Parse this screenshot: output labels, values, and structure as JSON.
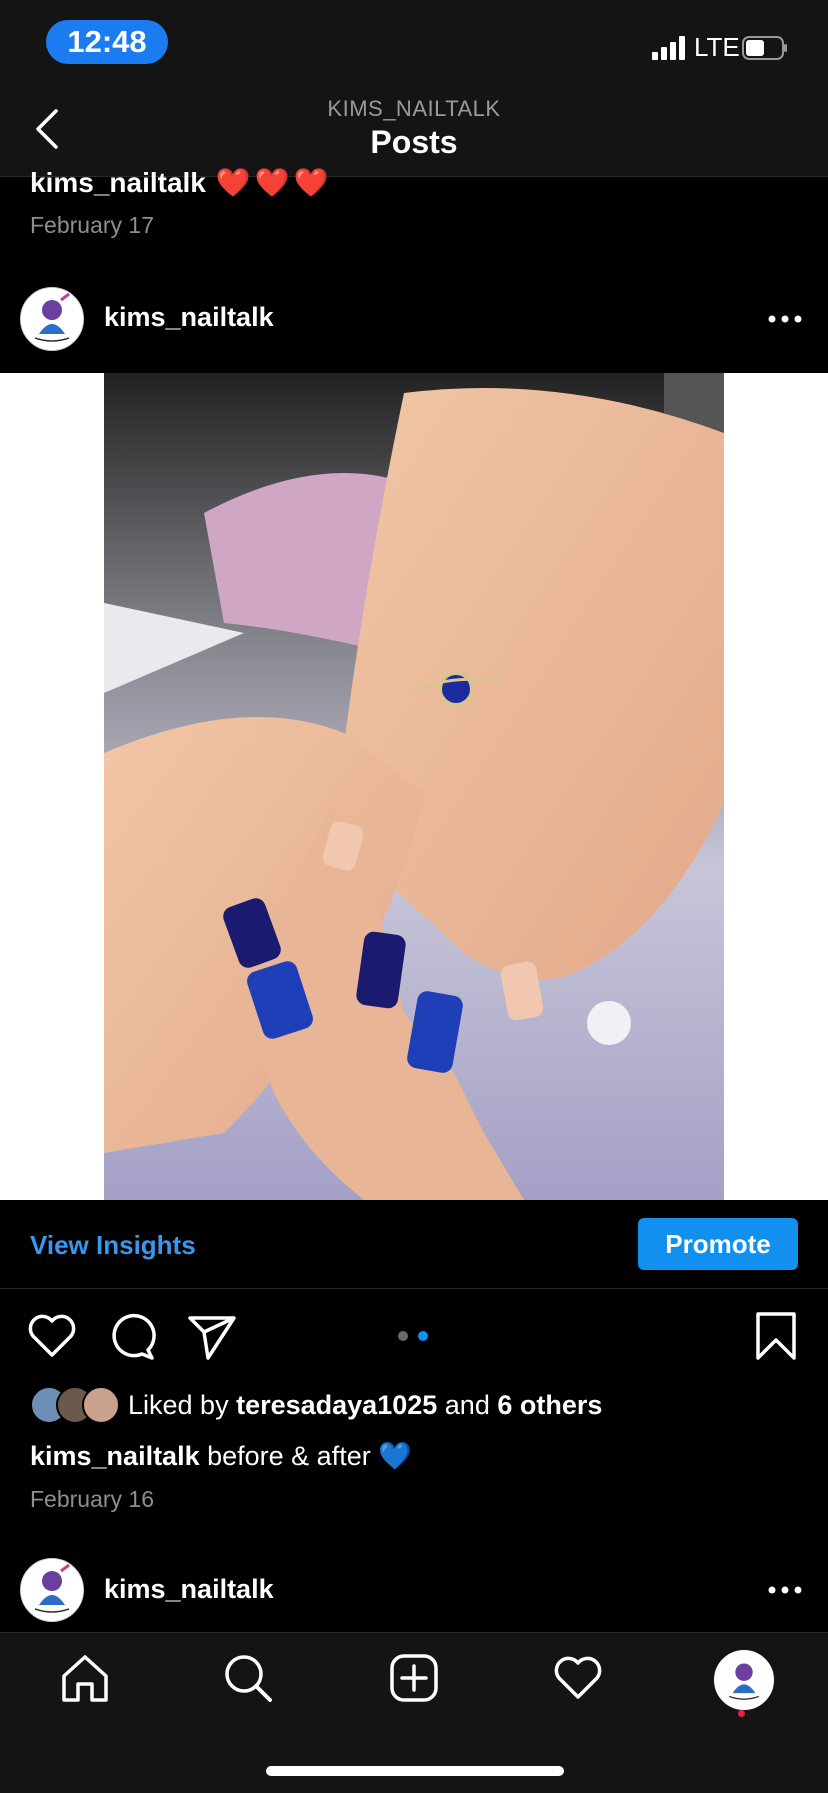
{
  "status": {
    "time": "12:48",
    "network": "LTE"
  },
  "nav": {
    "subtitle": "KIMS_NAILTALK",
    "title": "Posts"
  },
  "previous_post": {
    "username": "kims_nailtalk",
    "caption_emoji": "❤️❤️❤️",
    "date": "February 17"
  },
  "post": {
    "username": "kims_nailtalk",
    "view_insights": "View Insights",
    "promote": "Promote",
    "liked_prefix": "Liked by",
    "liked_user": "teresadaya1025",
    "liked_and": "and",
    "liked_others": "6 others",
    "caption_user": "kims_nailtalk",
    "caption_text": "before & after",
    "caption_emoji": "💙",
    "date": "February 16",
    "carousel_index": 2,
    "carousel_total": 2
  },
  "next_post": {
    "username": "kims_nailtalk"
  },
  "tabbar": {
    "items": [
      "home-icon",
      "search-icon",
      "new-post-icon",
      "activity-heart-icon",
      "profile-avatar"
    ]
  },
  "colors": {
    "accent": "#1190f0",
    "link": "#3a97f0",
    "heart_red": "#e0243b"
  }
}
